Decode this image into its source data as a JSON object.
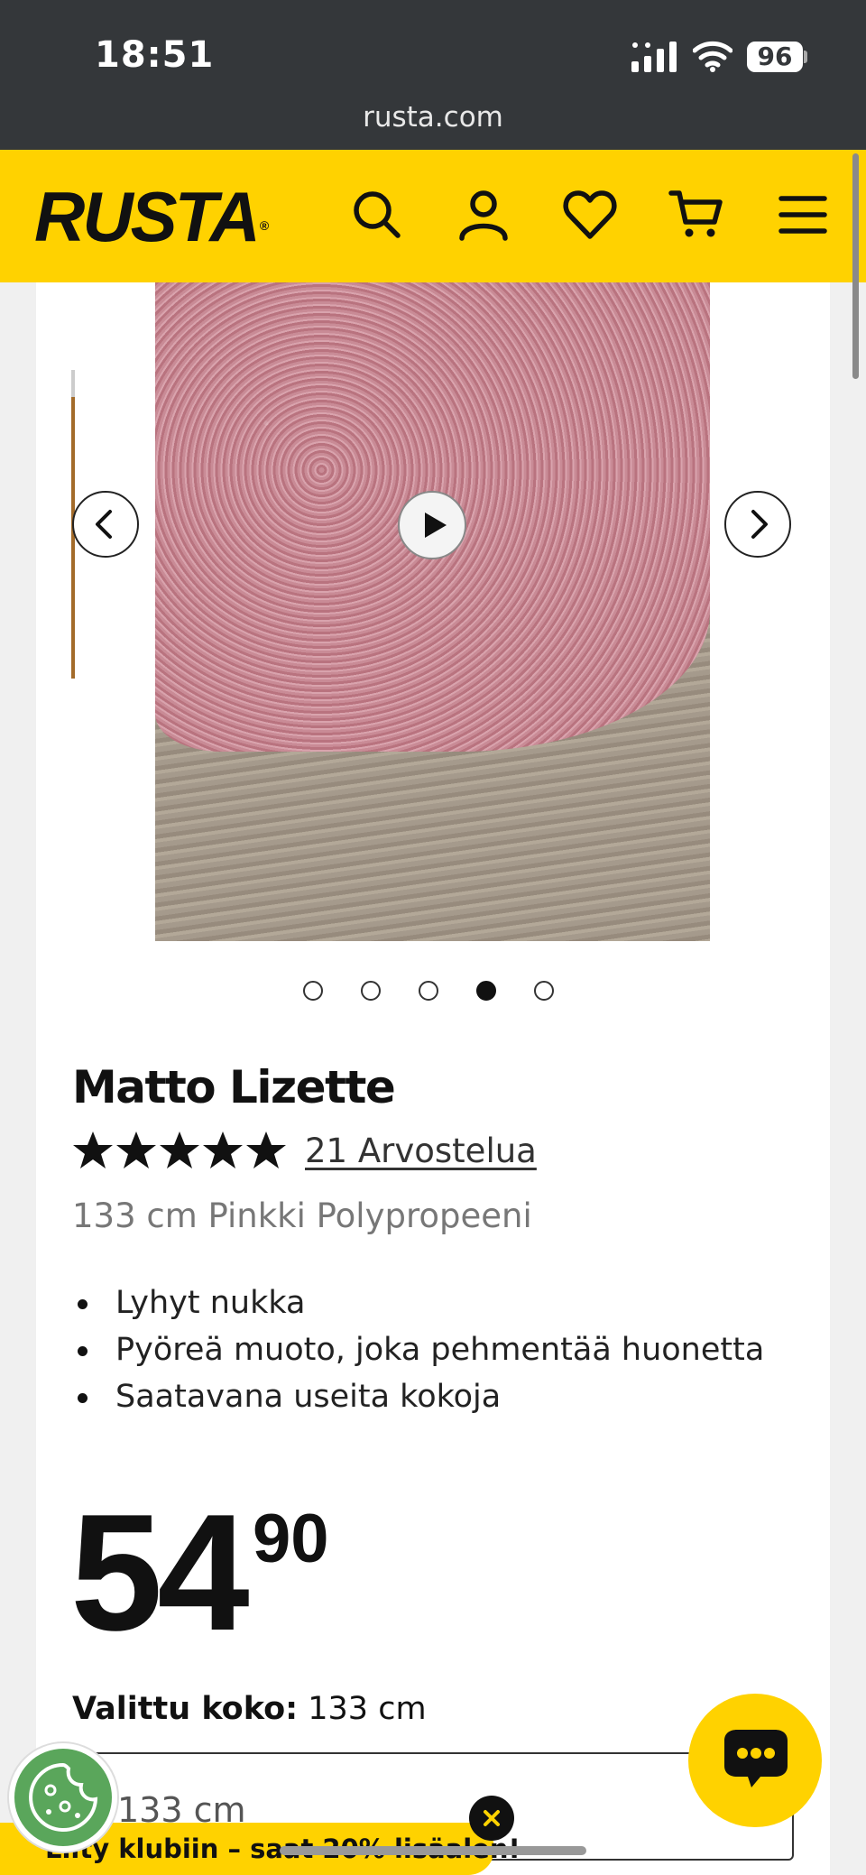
{
  "status_bar": {
    "time": "18:51",
    "battery": "96"
  },
  "browser": {
    "url": "rusta.com"
  },
  "header": {
    "logo": "RUSTA",
    "logo_mark": "®",
    "icons": [
      "search-icon",
      "account-icon",
      "wishlist-icon",
      "cart-icon",
      "menu-icon"
    ]
  },
  "gallery": {
    "active_index": 3,
    "dot_count": 5,
    "rug_color": "#c98b96"
  },
  "product": {
    "title": "Matto Lizette",
    "rating": 5,
    "reviews_label": "21 Arvostelua",
    "variant": "133 cm Pinkki Polypropeeni",
    "features": [
      "Lyhyt nukka",
      "Pyöreä muoto, joka pehmentää huonetta",
      "Saatavana useita kokoja"
    ],
    "price_int": "54",
    "price_dec": "90",
    "size_label": "Valittu koko:",
    "size_value": "133 cm",
    "size_select_value": "133 cm"
  },
  "promo": {
    "text": "Liity klubiin – saat 20% lisäalen!"
  },
  "colors": {
    "brand_yellow": "#ffd200",
    "header_dark": "#34373a",
    "cookie_green": "#5aa65b"
  }
}
